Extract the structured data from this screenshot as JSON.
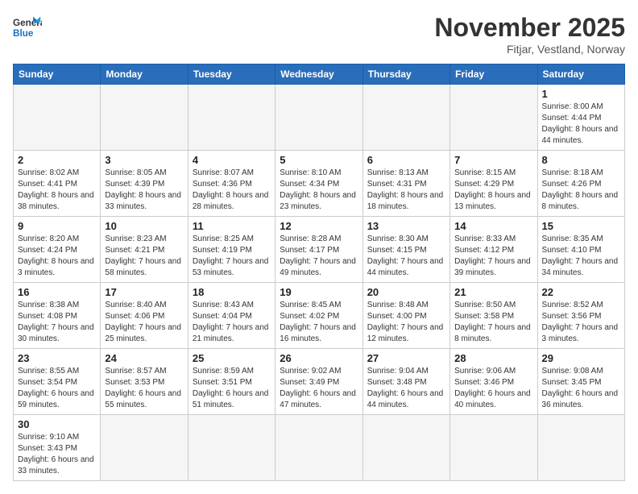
{
  "header": {
    "logo_general": "General",
    "logo_blue": "Blue",
    "title": "November 2025",
    "subtitle": "Fitjar, Vestland, Norway"
  },
  "days_of_week": [
    "Sunday",
    "Monday",
    "Tuesday",
    "Wednesday",
    "Thursday",
    "Friday",
    "Saturday"
  ],
  "weeks": [
    [
      {
        "num": "",
        "info": ""
      },
      {
        "num": "",
        "info": ""
      },
      {
        "num": "",
        "info": ""
      },
      {
        "num": "",
        "info": ""
      },
      {
        "num": "",
        "info": ""
      },
      {
        "num": "",
        "info": ""
      },
      {
        "num": "1",
        "info": "Sunrise: 8:00 AM\nSunset: 4:44 PM\nDaylight: 8 hours and 44 minutes."
      }
    ],
    [
      {
        "num": "2",
        "info": "Sunrise: 8:02 AM\nSunset: 4:41 PM\nDaylight: 8 hours and 38 minutes."
      },
      {
        "num": "3",
        "info": "Sunrise: 8:05 AM\nSunset: 4:39 PM\nDaylight: 8 hours and 33 minutes."
      },
      {
        "num": "4",
        "info": "Sunrise: 8:07 AM\nSunset: 4:36 PM\nDaylight: 8 hours and 28 minutes."
      },
      {
        "num": "5",
        "info": "Sunrise: 8:10 AM\nSunset: 4:34 PM\nDaylight: 8 hours and 23 minutes."
      },
      {
        "num": "6",
        "info": "Sunrise: 8:13 AM\nSunset: 4:31 PM\nDaylight: 8 hours and 18 minutes."
      },
      {
        "num": "7",
        "info": "Sunrise: 8:15 AM\nSunset: 4:29 PM\nDaylight: 8 hours and 13 minutes."
      },
      {
        "num": "8",
        "info": "Sunrise: 8:18 AM\nSunset: 4:26 PM\nDaylight: 8 hours and 8 minutes."
      }
    ],
    [
      {
        "num": "9",
        "info": "Sunrise: 8:20 AM\nSunset: 4:24 PM\nDaylight: 8 hours and 3 minutes."
      },
      {
        "num": "10",
        "info": "Sunrise: 8:23 AM\nSunset: 4:21 PM\nDaylight: 7 hours and 58 minutes."
      },
      {
        "num": "11",
        "info": "Sunrise: 8:25 AM\nSunset: 4:19 PM\nDaylight: 7 hours and 53 minutes."
      },
      {
        "num": "12",
        "info": "Sunrise: 8:28 AM\nSunset: 4:17 PM\nDaylight: 7 hours and 49 minutes."
      },
      {
        "num": "13",
        "info": "Sunrise: 8:30 AM\nSunset: 4:15 PM\nDaylight: 7 hours and 44 minutes."
      },
      {
        "num": "14",
        "info": "Sunrise: 8:33 AM\nSunset: 4:12 PM\nDaylight: 7 hours and 39 minutes."
      },
      {
        "num": "15",
        "info": "Sunrise: 8:35 AM\nSunset: 4:10 PM\nDaylight: 7 hours and 34 minutes."
      }
    ],
    [
      {
        "num": "16",
        "info": "Sunrise: 8:38 AM\nSunset: 4:08 PM\nDaylight: 7 hours and 30 minutes."
      },
      {
        "num": "17",
        "info": "Sunrise: 8:40 AM\nSunset: 4:06 PM\nDaylight: 7 hours and 25 minutes."
      },
      {
        "num": "18",
        "info": "Sunrise: 8:43 AM\nSunset: 4:04 PM\nDaylight: 7 hours and 21 minutes."
      },
      {
        "num": "19",
        "info": "Sunrise: 8:45 AM\nSunset: 4:02 PM\nDaylight: 7 hours and 16 minutes."
      },
      {
        "num": "20",
        "info": "Sunrise: 8:48 AM\nSunset: 4:00 PM\nDaylight: 7 hours and 12 minutes."
      },
      {
        "num": "21",
        "info": "Sunrise: 8:50 AM\nSunset: 3:58 PM\nDaylight: 7 hours and 8 minutes."
      },
      {
        "num": "22",
        "info": "Sunrise: 8:52 AM\nSunset: 3:56 PM\nDaylight: 7 hours and 3 minutes."
      }
    ],
    [
      {
        "num": "23",
        "info": "Sunrise: 8:55 AM\nSunset: 3:54 PM\nDaylight: 6 hours and 59 minutes."
      },
      {
        "num": "24",
        "info": "Sunrise: 8:57 AM\nSunset: 3:53 PM\nDaylight: 6 hours and 55 minutes."
      },
      {
        "num": "25",
        "info": "Sunrise: 8:59 AM\nSunset: 3:51 PM\nDaylight: 6 hours and 51 minutes."
      },
      {
        "num": "26",
        "info": "Sunrise: 9:02 AM\nSunset: 3:49 PM\nDaylight: 6 hours and 47 minutes."
      },
      {
        "num": "27",
        "info": "Sunrise: 9:04 AM\nSunset: 3:48 PM\nDaylight: 6 hours and 44 minutes."
      },
      {
        "num": "28",
        "info": "Sunrise: 9:06 AM\nSunset: 3:46 PM\nDaylight: 6 hours and 40 minutes."
      },
      {
        "num": "29",
        "info": "Sunrise: 9:08 AM\nSunset: 3:45 PM\nDaylight: 6 hours and 36 minutes."
      }
    ],
    [
      {
        "num": "30",
        "info": "Sunrise: 9:10 AM\nSunset: 3:43 PM\nDaylight: 6 hours and 33 minutes."
      },
      {
        "num": "",
        "info": ""
      },
      {
        "num": "",
        "info": ""
      },
      {
        "num": "",
        "info": ""
      },
      {
        "num": "",
        "info": ""
      },
      {
        "num": "",
        "info": ""
      },
      {
        "num": "",
        "info": ""
      }
    ]
  ]
}
